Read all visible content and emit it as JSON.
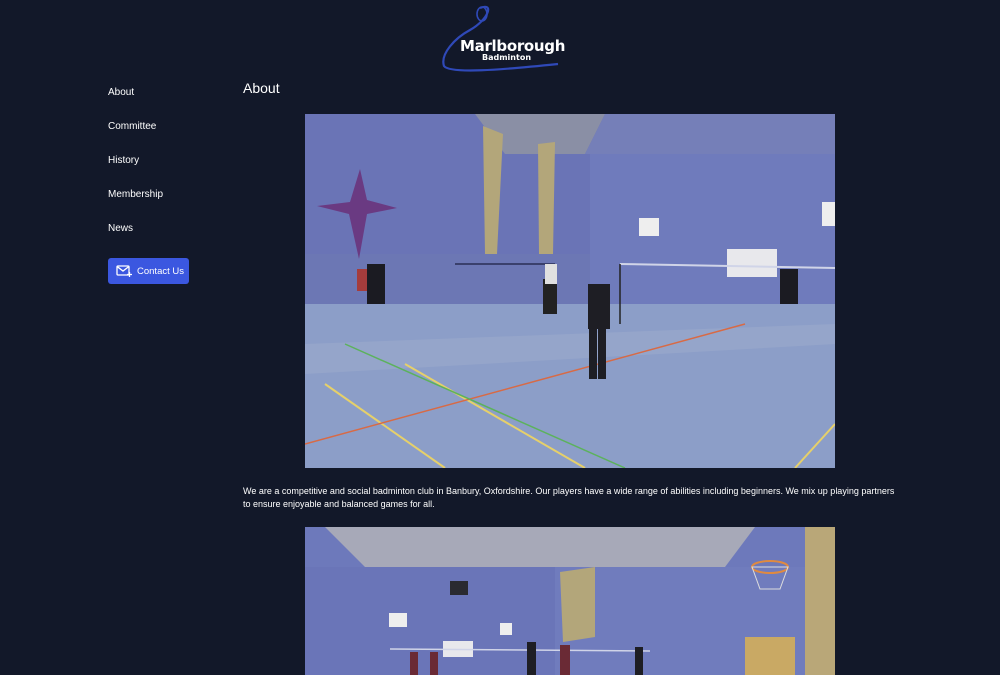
{
  "logo": {
    "title": "Marlborough",
    "subtitle": "Badminton"
  },
  "nav": {
    "items": [
      {
        "label": "About"
      },
      {
        "label": "Committee"
      },
      {
        "label": "History"
      },
      {
        "label": "Membership"
      },
      {
        "label": "News"
      }
    ],
    "contact_label": "Contact Us",
    "contact_icon": "mail-plus-icon"
  },
  "main": {
    "title": "About",
    "intro": "We are a competitive and social badminton club in Banbury, Oxfordshire. Our players have a wide range of abilities including beginners. We mix up playing partners to ensure enjoyable and balanced games for all."
  },
  "colors": {
    "background": "#121829",
    "accent": "#3b57e0",
    "text": "#ffffff"
  }
}
